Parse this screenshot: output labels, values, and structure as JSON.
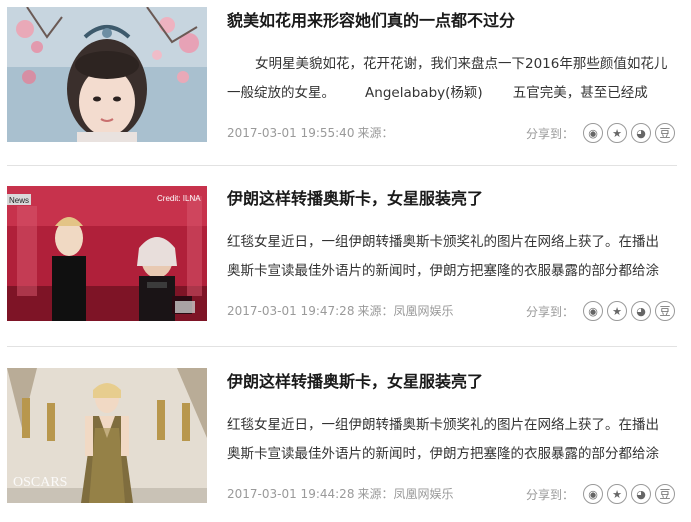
{
  "articles": [
    {
      "title": "貌美如花用来形容她们真的一点都不过分",
      "summary": "女明星美貌如花，花开花谢，我们来盘点一下2016年那些颜值如花儿一般绽放的女星。       Angelababy(杨颖)       五官完美，甚至已经成",
      "date": "2017-03-01 19:55:40",
      "source": "来源：",
      "share_label": "分享到："
    },
    {
      "title": "伊朗这样转播奥斯卡，女星服装亮了",
      "summary": "红毯女星近日，一组伊朗转播奥斯卡颁奖礼的图片在网络上获了。在播出奥斯卡宣读最佳外语片的新闻时，伊朗方把塞隆的衣服暴露的部分都给涂",
      "date": "2017-03-01 19:47:28",
      "source": "来源：凤凰网娱乐",
      "share_label": "分享到：",
      "image_text": {
        "credit": "Credit: ILNA",
        "badge": "News"
      }
    },
    {
      "title": "伊朗这样转播奥斯卡，女星服装亮了",
      "summary": "红毯女星近日，一组伊朗转播奥斯卡颁奖礼的图片在网络上获了。在播出奥斯卡宣读最佳外语片的新闻时，伊朗方把塞隆的衣服暴露的部分都给涂",
      "date": "2017-03-01 19:44:28",
      "source": "来源：凤凰网娱乐",
      "share_label": "分享到：",
      "image_text": {
        "backdrop": "OSCARS"
      }
    }
  ],
  "share_icons": [
    {
      "name": "weibo-icon",
      "glyph": "◉"
    },
    {
      "name": "qzone-icon",
      "glyph": "★"
    },
    {
      "name": "wechat-icon",
      "glyph": "◕"
    },
    {
      "name": "douban-icon",
      "glyph": "豆"
    }
  ],
  "colors": {
    "title": "#1a1a1a",
    "summary": "#333333",
    "meta": "#9a9a9a",
    "divider": "#e2e2e2"
  }
}
